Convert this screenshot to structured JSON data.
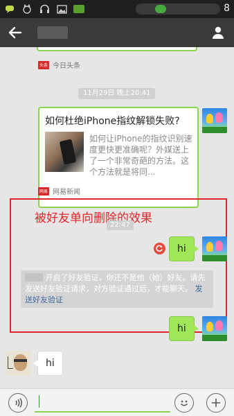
{
  "status_bar": {
    "clock": "8",
    "icons": [
      "chat-icon",
      "cat-icon",
      "headset-icon",
      "image-icon",
      "mail-icon"
    ]
  },
  "header": {
    "back_icon": "arrow-left-icon",
    "menu_icon": "person-menu-icon"
  },
  "messages": {
    "source_top": {
      "logo": "头条",
      "name": "今日头条"
    },
    "timestamp_1": "11月29日 晚上20:41",
    "news_card": {
      "title": "如何杜绝iPhone指纹解锁失败?",
      "description": "如何让iPhone的指纹识别速度更快更准确呢？外媒送上了一个非常奇葩的方法。这个方法就是将同..."
    },
    "source_bottom": {
      "logo": "网易",
      "name": "网易新闻"
    },
    "annotation": "被好友单向删除的效果",
    "timestamp_2": "22:47",
    "sent_1": "hi",
    "system_note": {
      "before_name": "",
      "text": "开启了好友验证，你还不是他（她）好友。请先发送好友验证请求，对方验证通过后，才能聊天。",
      "link": "发送好友验证"
    },
    "sent_2": "hi",
    "received_1": "hi"
  },
  "input_bar": {
    "voice_icon": "voice-icon",
    "emoji_icon": "emoji-icon",
    "plus_icon": "plus-icon",
    "input_value": ""
  },
  "colors": {
    "header_bg": "#3a3a3a",
    "bubble_green": "#9fe658",
    "annotation_red": "#e0262b",
    "link_blue": "#3d6aa3"
  }
}
